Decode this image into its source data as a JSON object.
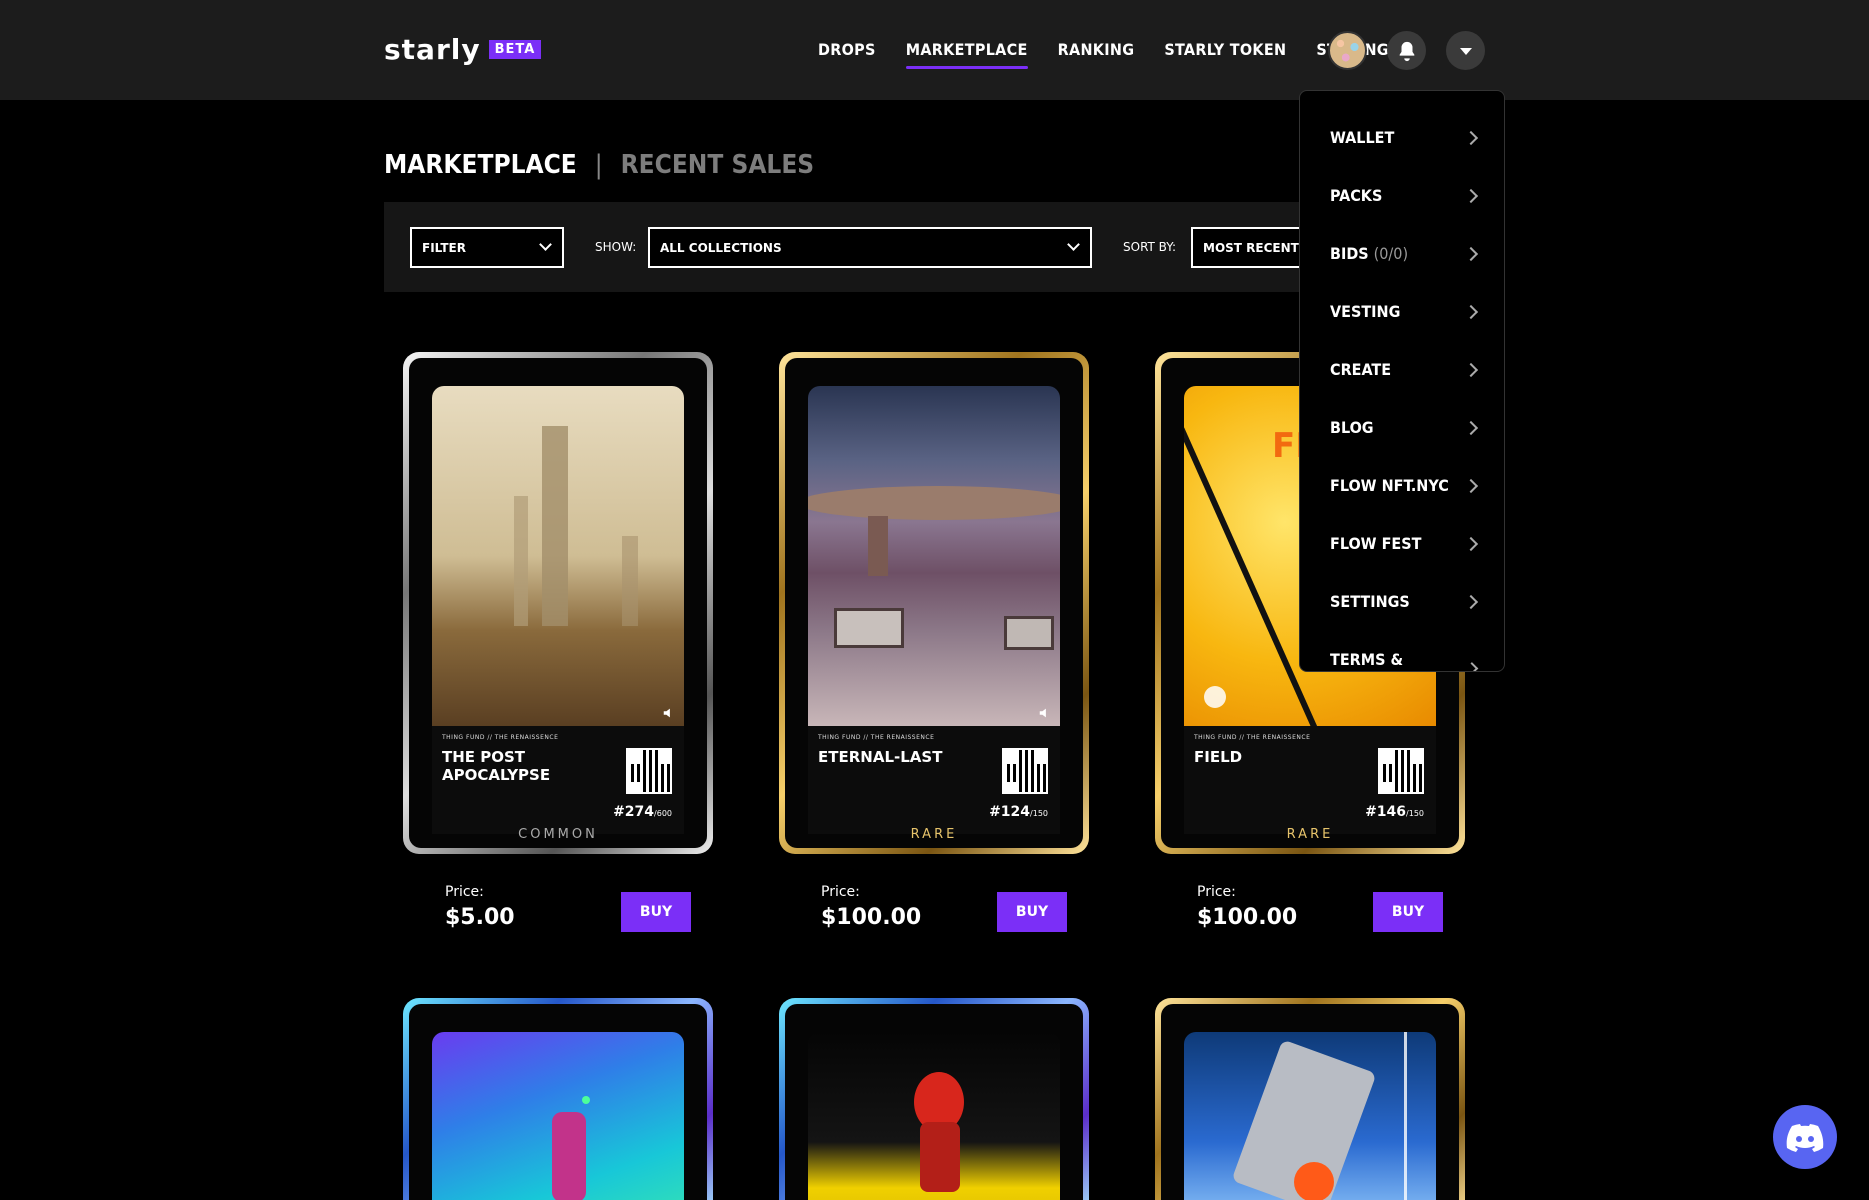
{
  "header": {
    "logo_text": "starly",
    "beta_badge": "BETA",
    "nav": [
      "DROPS",
      "MARKETPLACE",
      "RANKING",
      "STARLY TOKEN",
      "STAKING"
    ],
    "active_nav": "MARKETPLACE"
  },
  "menu": {
    "items": [
      {
        "label": "WALLET"
      },
      {
        "label": "PACKS"
      },
      {
        "label": "BIDS",
        "sub": "(0/0)"
      },
      {
        "label": "VESTING"
      },
      {
        "label": "CREATE"
      },
      {
        "label": "BLOG"
      },
      {
        "label": "FLOW NFT.NYC"
      },
      {
        "label": "FLOW FEST"
      },
      {
        "label": "SETTINGS"
      },
      {
        "label": "TERMS & PRIVACY"
      }
    ]
  },
  "page": {
    "title": "MARKETPLACE",
    "separator": "|",
    "secondary_tab": "RECENT SALES"
  },
  "filters": {
    "filter_value": "FILTER",
    "show_label": "SHOW:",
    "show_value": "ALL COLLECTIONS",
    "sort_label": "SORT BY:",
    "sort_value": "MOST RECENT"
  },
  "cards": [
    {
      "collection": "THING FUND // THE RENAISSENCE",
      "title": "THE POST APOCALYPSE",
      "serial": "#274",
      "edition": "/600",
      "tier": "COMMON",
      "price_label": "Price:",
      "price": "$5.00",
      "buy": "BUY"
    },
    {
      "collection": "THING FUND // THE RENAISSENCE",
      "title": "ETERNAL-LAST",
      "serial": "#124",
      "edition": "/150",
      "tier": "RARE",
      "price_label": "Price:",
      "price": "$100.00",
      "buy": "BUY"
    },
    {
      "collection": "THING FUND // THE RENAISSENCE",
      "title": "FIELD",
      "serial": "#146",
      "edition": "/150",
      "tier": "RARE",
      "price_label": "Price:",
      "price": "$100.00",
      "buy": "BUY",
      "art_text": "FI"
    }
  ],
  "colors": {
    "accent": "#7b2ff7",
    "header_bg": "#1c1c1c",
    "discord": "#5865f2"
  }
}
